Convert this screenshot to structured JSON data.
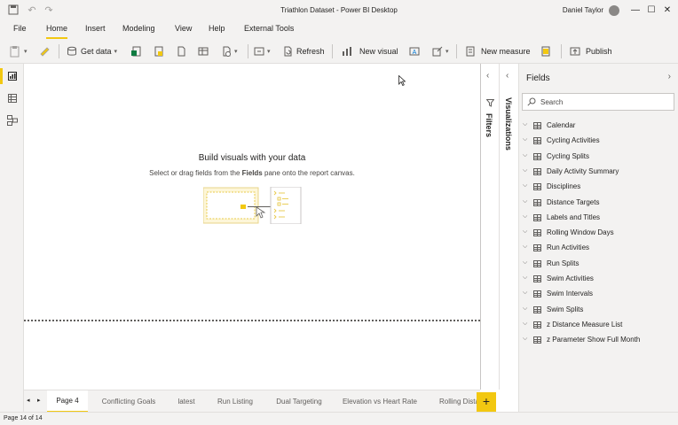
{
  "app": {
    "title": "Triathlon Dataset - Power BI Desktop",
    "user": "Daniel Taylor"
  },
  "menu": {
    "tabs": [
      "File",
      "Home",
      "Insert",
      "Modeling",
      "View",
      "Help",
      "External Tools"
    ],
    "active": "Home"
  },
  "ribbon": {
    "get_data": "Get data",
    "refresh": "Refresh",
    "new_visual": "New visual",
    "new_measure": "New measure",
    "publish": "Publish"
  },
  "canvas": {
    "empty_title": "Build visuals with your data",
    "empty_sub_pre": "Select or drag fields from the ",
    "empty_sub_bold": "Fields",
    "empty_sub_post": " pane onto the report canvas."
  },
  "panes": {
    "filters": "Filters",
    "visualizations": "Visualizations"
  },
  "fields": {
    "title": "Fields",
    "search_placeholder": "Search",
    "tables": [
      "Calendar",
      "Cycling Activities",
      "Cycling Splits",
      "Daily Activity Summary",
      "Disciplines",
      "Distance Targets",
      "Labels and Titles",
      "Rolling Window Days",
      "Run Activities",
      "Run Splits",
      "Swim Activities",
      "Swim Intervals",
      "Swim Splits",
      "z Distance Measure List",
      "z Parameter Show Full Month"
    ]
  },
  "pages": {
    "tabs": [
      "Page 4",
      "Conflicting Goals",
      "latest",
      "Run Listing",
      "Dual Targeting",
      "Elevation vs Heart Rate",
      "Rolling Dista"
    ],
    "active": "Page 4",
    "add_label": "+"
  },
  "status": {
    "text": "Page 14 of 14"
  },
  "colors": {
    "accent": "#f2c811",
    "chrome": "#f3f2f1"
  }
}
